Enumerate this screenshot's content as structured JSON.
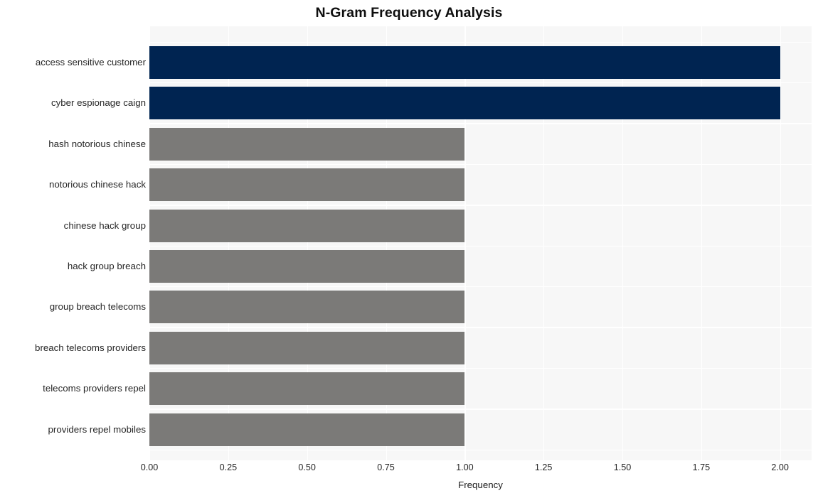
{
  "chart_data": {
    "type": "bar",
    "orientation": "horizontal",
    "title": "N-Gram Frequency Analysis",
    "xlabel": "Frequency",
    "ylabel": "",
    "categories": [
      "access sensitive customer",
      "cyber espionage caign",
      "hash notorious chinese",
      "notorious chinese hack",
      "chinese hack group",
      "hack group breach",
      "group breach telecoms",
      "breach telecoms providers",
      "telecoms providers repel",
      "providers repel mobiles"
    ],
    "values": [
      2,
      2,
      1,
      1,
      1,
      1,
      1,
      1,
      1,
      1
    ],
    "bar_colors": [
      "#002451",
      "#002451",
      "#7b7a78",
      "#7b7a78",
      "#7b7a78",
      "#7b7a78",
      "#7b7a78",
      "#7b7a78",
      "#7b7a78",
      "#7b7a78"
    ],
    "xlim": [
      0,
      2.1
    ],
    "xticks": [
      0,
      0.25,
      0.5,
      0.75,
      1.0,
      1.25,
      1.5,
      1.75,
      2.0
    ],
    "xtick_labels": [
      "0.00",
      "0.25",
      "0.50",
      "0.75",
      "1.00",
      "1.25",
      "1.50",
      "1.75",
      "2.00"
    ],
    "grid": true,
    "grid_color": "#ffffff",
    "plot_background": "#f7f7f7",
    "figure_background": "#ffffff",
    "legend": null,
    "highlight_color": "#002451",
    "base_color": "#7b7a78"
  }
}
